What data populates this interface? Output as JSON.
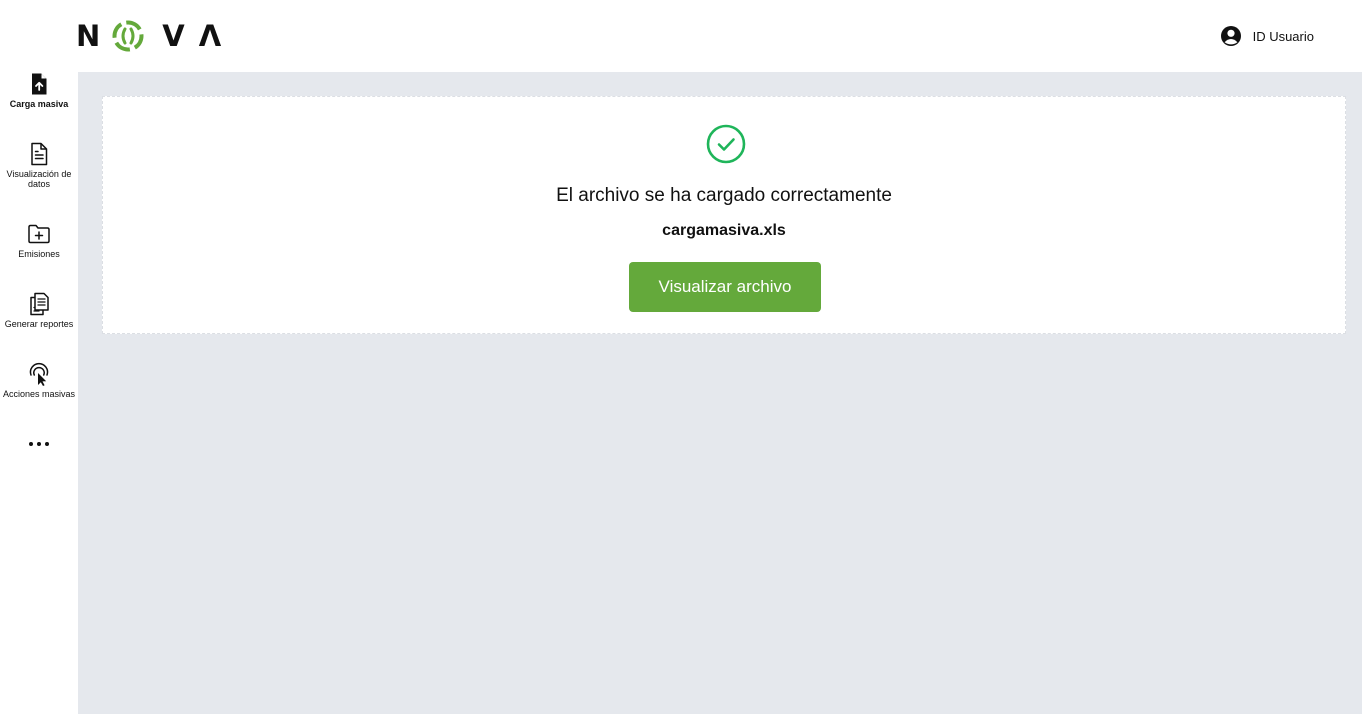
{
  "brand": {
    "letters": [
      "N",
      "V",
      "Λ"
    ],
    "colors": {
      "primary": "#64a93b",
      "success": "#1fb55a",
      "text": "#111111",
      "background": "#e5e8ed"
    }
  },
  "header": {
    "user_icon": "user-circle-icon",
    "user_label": "ID Usuario"
  },
  "sidebar": {
    "items": [
      {
        "label": "Carga masiva",
        "icon": "file-upload-icon",
        "active": true
      },
      {
        "label": "Visualización de datos",
        "icon": "document-icon",
        "active": false
      },
      {
        "label": "Emisiones",
        "icon": "folder-plus-icon",
        "active": false
      },
      {
        "label": "Generar reportes",
        "icon": "reports-icon",
        "active": false
      },
      {
        "label": "Acciones masivas",
        "icon": "touch-click-icon",
        "active": false
      }
    ],
    "more_icon": "more-horizontal-icon"
  },
  "main": {
    "success_icon": "check-circle-icon",
    "message": "El archivo se ha cargado correctamente",
    "filename": "cargamasiva.xls",
    "view_button_label": "Visualizar archivo"
  }
}
